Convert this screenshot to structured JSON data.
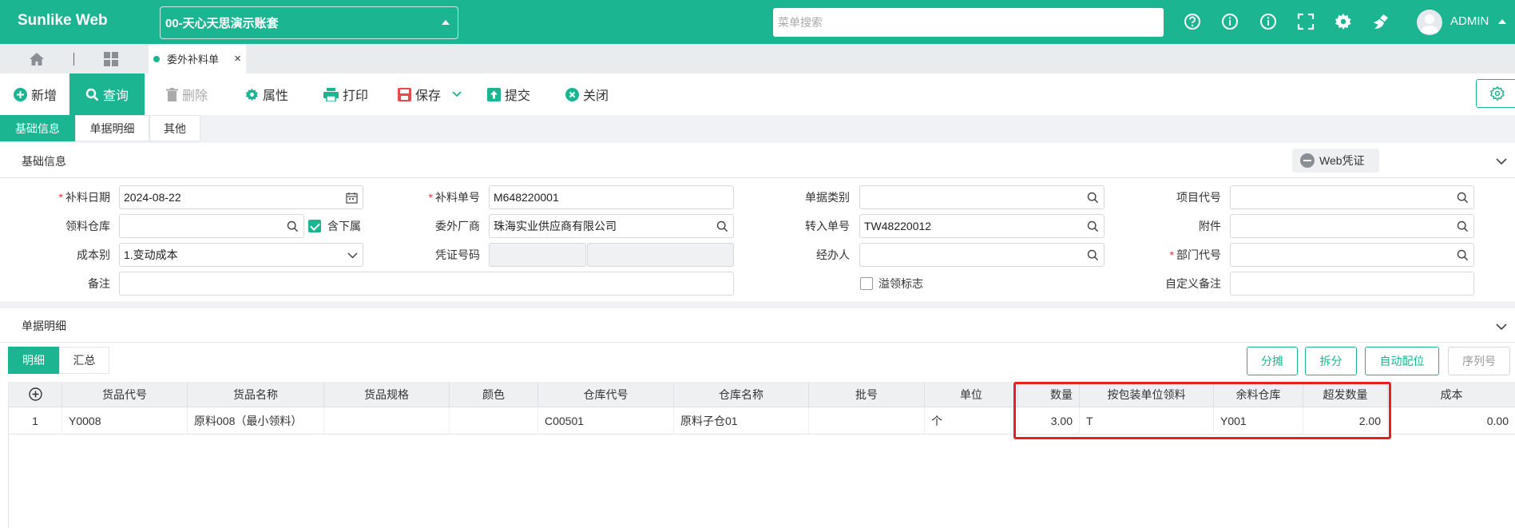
{
  "brand": "Sunlike Web",
  "account": "00-天心天思演示账套",
  "menu_search": {
    "placeholder": "菜单搜索"
  },
  "user": {
    "name": "ADMIN"
  },
  "open_tab": {
    "label": "委外补料单"
  },
  "toolbar": {
    "new": "新增",
    "query": "查询",
    "delete": "删除",
    "properties": "属性",
    "print": "打印",
    "save": "保存",
    "submit": "提交",
    "close": "关闭"
  },
  "subtabs": [
    "基础信息",
    "单据明细",
    "其他"
  ],
  "basic": {
    "title": "基础信息",
    "web_voucher": "Web凭证",
    "fields": {
      "supply_date": {
        "label": "补料日期",
        "value": "2024-08-22"
      },
      "supply_no": {
        "label": "补料单号",
        "value": "M648220001"
      },
      "doc_type": {
        "label": "单据类别",
        "value": ""
      },
      "project_code": {
        "label": "项目代号",
        "value": ""
      },
      "warehouse": {
        "label": "领料仓库",
        "value": ""
      },
      "include_sub": {
        "label": "含下属",
        "checked": true
      },
      "vendor": {
        "label": "委外厂商",
        "value": "珠海实业供应商有限公司"
      },
      "transfer_no": {
        "label": "转入单号",
        "value": "TW48220012"
      },
      "attachment": {
        "label": "附件",
        "value": ""
      },
      "cost_type": {
        "label": "成本别",
        "value": "1.变动成本"
      },
      "voucher_no": {
        "label": "凭证号码",
        "value": ""
      },
      "handler": {
        "label": "经办人",
        "value": ""
      },
      "dept_code": {
        "label": "部门代号",
        "value": ""
      },
      "remark": {
        "label": "备注",
        "value": ""
      },
      "overflow_flag": {
        "label": "溢领标志",
        "checked": false
      },
      "custom_remark": {
        "label": "自定义备注",
        "value": ""
      }
    }
  },
  "details": {
    "title": "单据明细",
    "tabs": [
      "明细",
      "汇总"
    ],
    "buttons": {
      "allocate": "分摊",
      "split": "拆分",
      "auto_batch": "自动配位",
      "serial": "序列号"
    },
    "columns": [
      "货品代号",
      "货品名称",
      "货品规格",
      "颜色",
      "仓库代号",
      "仓库名称",
      "批号",
      "单位",
      "数量",
      "按包装单位领料",
      "余料仓库",
      "超发数量",
      "成本"
    ],
    "rows": [
      {
        "no": "1",
        "item_code": "Y0008",
        "item_name": "原料008（最小领料）",
        "spec": "",
        "color": "",
        "wh_code": "C00501",
        "wh_name": "原料子仓01",
        "batch": "",
        "unit": "个",
        "qty": "3.00",
        "by_pack": "T",
        "remain_wh": "Y001",
        "over_qty": "2.00",
        "cost": "0.00"
      }
    ]
  },
  "colors": {
    "primary": "#1bb591",
    "highlight": "#e52020"
  }
}
